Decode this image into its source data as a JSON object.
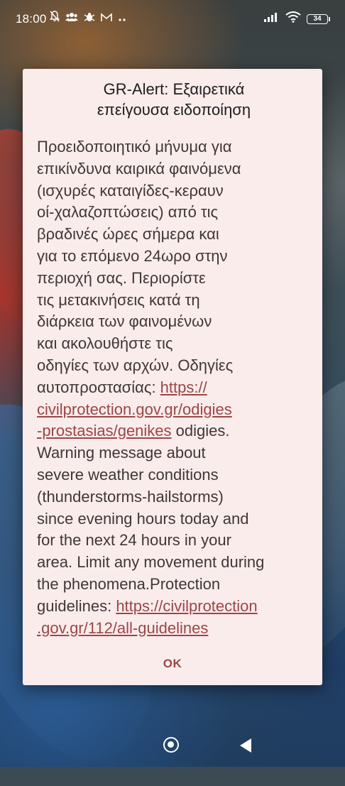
{
  "status_bar": {
    "time": "18:00",
    "left_icons": [
      "mute-bell-icon",
      "group-icon",
      "bug-icon",
      "gmail-icon",
      "more-dots-icon"
    ],
    "right_icons": [
      "signal-icon",
      "wifi-icon"
    ],
    "battery_level": "34"
  },
  "alert_dialog": {
    "title_line1": "GR-Alert: Εξαιρετικά",
    "title_line2": "επείγουσα ειδοποίηση",
    "body_greek_intro": "Προειδοποιητικό μήνυμα για\nεπικίνδυνα καιρικά φαινόμενα\n(ισχυρές καταιγίδες-κεραυν\nοί-χαλαζοπτώσεις) από τις\nβραδινές ώρες σήμερα και\nγια το επόμενο 24ωρο στην\nπεριοχή σας. Περιορίστε\nτις μετακινήσεις κατά τη\nδιάρκεια των φαινομένων\nκαι ακολουθήστε τις\nοδηγίες των αρχών. Οδηγίες\nαυτοπροστασίας: ",
    "link1_line1": "https://",
    "link1_line2": "civilprotection.gov.gr/odigies",
    "link1_line3": "-prostasias/genikes",
    "body_after_link1": " odigies.\nWarning message about\nsevere weather conditions\n(thunderstorms-hailstorms)\nsince evening hours today and\nfor the next 24 hours in your\narea. Limit any movement during\nthe phenomena.Protection\nguidelines: ",
    "link2_line1": "https://civilprotection",
    "link2_line2": ".gov.gr/112/all-guidelines",
    "ok_label": "OK",
    "accent_color": "#9b4646",
    "background_color": "#fbecec"
  },
  "nav_bar": {
    "home_icon": "home-circle-icon",
    "back_icon": "back-triangle-icon"
  }
}
